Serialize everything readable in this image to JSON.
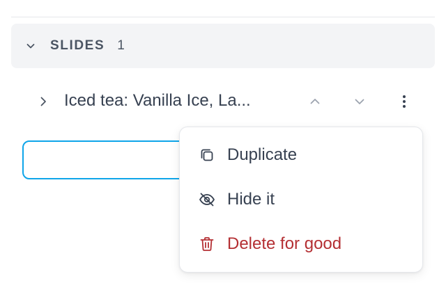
{
  "section": {
    "title": "SLIDES",
    "count": "1"
  },
  "slide": {
    "title": "Iced tea: Vanilla Ice, La..."
  },
  "input": {
    "value": ""
  },
  "menu": {
    "items": [
      {
        "label": "Duplicate",
        "icon": "duplicate-icon"
      },
      {
        "label": "Hide it",
        "icon": "eye-off-icon"
      },
      {
        "label": "Delete for good",
        "icon": "trash-icon"
      }
    ]
  },
  "colors": {
    "header_bg": "#f3f4f6",
    "text": "#374151",
    "danger": "#b42f33",
    "focus_border": "#0ea5e9"
  }
}
